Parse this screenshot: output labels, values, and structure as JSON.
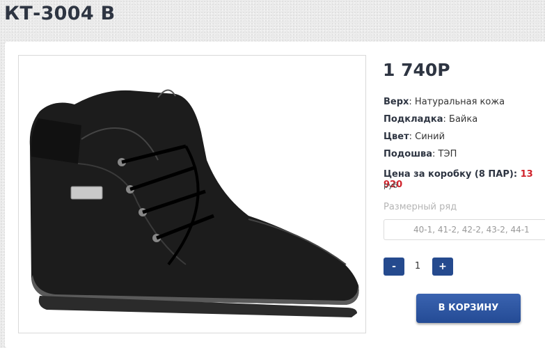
{
  "product": {
    "title": "КТ-3004 В",
    "price": "1 740Р",
    "specs": [
      {
        "label": "Верх",
        "value": ": Натуральная кожа"
      },
      {
        "label": "Подкладка",
        "value": ": Байка"
      },
      {
        "label": "Цвет",
        "value": ": Синий"
      },
      {
        "label": "Подошва",
        "value": ": ТЭП"
      }
    ],
    "box_price": {
      "label": "Цена за коробку (8 ПАР):",
      "value": "13 920",
      "currency": "руб"
    },
    "size_row": {
      "label": "Размерный ряд",
      "selected": "40-1, 41-2, 42-2, 43-2, 44-1"
    },
    "quantity": {
      "minus": "-",
      "value": "1",
      "plus": "+"
    },
    "cart_button": "В КОРЗИНУ",
    "photo_icon": "shoe-photo-icon"
  }
}
